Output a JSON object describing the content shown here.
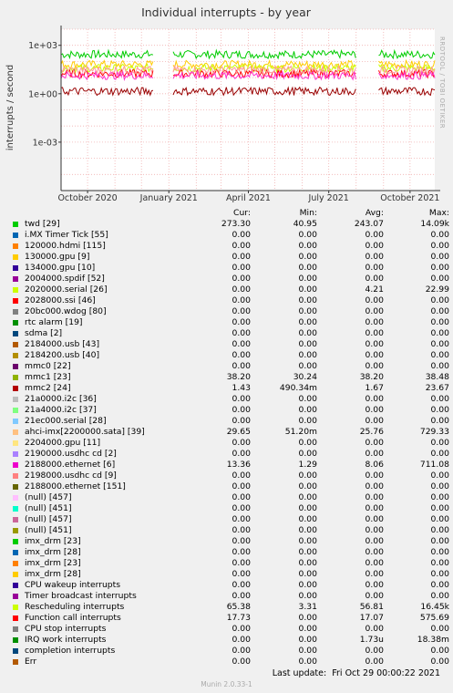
{
  "chart_data": {
    "type": "line",
    "title": "Individual interrupts - by year",
    "ylabel": "interrupts / second",
    "yscale": "log",
    "ylim": [
      1e-06,
      10000
    ],
    "y_ticks": [
      {
        "value": 1000,
        "label": "1e+03"
      },
      {
        "value": 1,
        "label": "1e+00"
      },
      {
        "value": 0.001,
        "label": "1e-03"
      }
    ],
    "xlim": [
      "2020-09-01",
      "2021-10-29"
    ],
    "x_ticks": [
      {
        "value": "2020-10-01",
        "label": "October 2020"
      },
      {
        "value": "2021-01-01",
        "label": "January 2021"
      },
      {
        "value": "2021-04-01",
        "label": "April 2021"
      },
      {
        "value": "2021-07-01",
        "label": "July 2021"
      },
      {
        "value": "2021-10-01",
        "label": "October 2021"
      }
    ],
    "grid": true,
    "gaps": [
      [
        "2020-12-15",
        "2021-01-05"
      ],
      [
        "2021-08-01",
        "2021-08-25"
      ]
    ],
    "series": [
      {
        "name": "twd [29]",
        "color": "#00cc00",
        "value": 273.3
      },
      {
        "name": "Rescheduling interrupts",
        "color": "#ffcc00",
        "value": 65.38
      },
      {
        "name": "mmc1 [23]",
        "color": "#ccff00",
        "value": 38.2
      },
      {
        "name": "Function call interrupts",
        "color": "#ff0000",
        "value": 17.73
      },
      {
        "name": "ahci-imx[2200000.sata] [39]",
        "color": "#ff9999",
        "value": 29.65
      },
      {
        "name": "2188000.ethernet [6]",
        "color": "#ff33cc",
        "value": 13.36
      },
      {
        "name": "mmc2 [24]",
        "color": "#990000",
        "value": 1.43
      }
    ]
  },
  "sidebar_text": "RRDTOOL / TOBI OETIKER",
  "legend": {
    "headers": {
      "cur": "Cur:",
      "min": "Min:",
      "avg": "Avg:",
      "max": "Max:"
    },
    "rows": [
      {
        "name": "twd [29]",
        "color": "#00cc00",
        "cur": "273.30",
        "min": "40.95",
        "avg": "243.07",
        "max": "14.09k"
      },
      {
        "name": "i.MX Timer Tick [55]",
        "color": "#0066b3",
        "cur": "0.00",
        "min": "0.00",
        "avg": "0.00",
        "max": "0.00"
      },
      {
        "name": "120000.hdmi [115]",
        "color": "#ff8000",
        "cur": "0.00",
        "min": "0.00",
        "avg": "0.00",
        "max": "0.00"
      },
      {
        "name": "130000.gpu [9]",
        "color": "#ffcc00",
        "cur": "0.00",
        "min": "0.00",
        "avg": "0.00",
        "max": "0.00"
      },
      {
        "name": "134000.gpu [10]",
        "color": "#330099",
        "cur": "0.00",
        "min": "0.00",
        "avg": "0.00",
        "max": "0.00"
      },
      {
        "name": "2004000.spdif [52]",
        "color": "#990099",
        "cur": "0.00",
        "min": "0.00",
        "avg": "0.00",
        "max": "0.00"
      },
      {
        "name": "2020000.serial [26]",
        "color": "#ccff00",
        "cur": "0.00",
        "min": "0.00",
        "avg": "4.21",
        "max": "22.99"
      },
      {
        "name": "2028000.ssi [46]",
        "color": "#ff0000",
        "cur": "0.00",
        "min": "0.00",
        "avg": "0.00",
        "max": "0.00"
      },
      {
        "name": "20bc000.wdog [80]",
        "color": "#808080",
        "cur": "0.00",
        "min": "0.00",
        "avg": "0.00",
        "max": "0.00"
      },
      {
        "name": "rtc alarm [19]",
        "color": "#008f00",
        "cur": "0.00",
        "min": "0.00",
        "avg": "0.00",
        "max": "0.00"
      },
      {
        "name": "sdma [2]",
        "color": "#00487d",
        "cur": "0.00",
        "min": "0.00",
        "avg": "0.00",
        "max": "0.00"
      },
      {
        "name": "2184000.usb [43]",
        "color": "#b35a00",
        "cur": "0.00",
        "min": "0.00",
        "avg": "0.00",
        "max": "0.00"
      },
      {
        "name": "2184200.usb [40]",
        "color": "#b38f00",
        "cur": "0.00",
        "min": "0.00",
        "avg": "0.00",
        "max": "0.00"
      },
      {
        "name": "mmc0 [22]",
        "color": "#6b006b",
        "cur": "0.00",
        "min": "0.00",
        "avg": "0.00",
        "max": "0.00"
      },
      {
        "name": "mmc1 [23]",
        "color": "#8fb300",
        "cur": "38.20",
        "min": "30.24",
        "avg": "38.20",
        "max": "38.48"
      },
      {
        "name": "mmc2 [24]",
        "color": "#b30000",
        "cur": "1.43",
        "min": "490.34m",
        "avg": "1.67",
        "max": "23.67"
      },
      {
        "name": "21a0000.i2c [36]",
        "color": "#bebebe",
        "cur": "0.00",
        "min": "0.00",
        "avg": "0.00",
        "max": "0.00"
      },
      {
        "name": "21a4000.i2c [37]",
        "color": "#80ff80",
        "cur": "0.00",
        "min": "0.00",
        "avg": "0.00",
        "max": "0.00"
      },
      {
        "name": "21ec000.serial [28]",
        "color": "#80c9ff",
        "cur": "0.00",
        "min": "0.00",
        "avg": "0.00",
        "max": "0.00"
      },
      {
        "name": "ahci-imx[2200000.sata] [39]",
        "color": "#ffc080",
        "cur": "29.65",
        "min": "51.20m",
        "avg": "25.76",
        "max": "729.33"
      },
      {
        "name": "2204000.gpu [11]",
        "color": "#ffe680",
        "cur": "0.00",
        "min": "0.00",
        "avg": "0.00",
        "max": "0.00"
      },
      {
        "name": "2190000.usdhc cd [2]",
        "color": "#aa80ff",
        "cur": "0.00",
        "min": "0.00",
        "avg": "0.00",
        "max": "0.00"
      },
      {
        "name": "2188000.ethernet [6]",
        "color": "#ee00cc",
        "cur": "13.36",
        "min": "1.29",
        "avg": "8.06",
        "max": "711.08"
      },
      {
        "name": "2198000.usdhc cd [9]",
        "color": "#ff8080",
        "cur": "0.00",
        "min": "0.00",
        "avg": "0.00",
        "max": "0.00"
      },
      {
        "name": "2188000.ethernet [151]",
        "color": "#666600",
        "cur": "0.00",
        "min": "0.00",
        "avg": "0.00",
        "max": "0.00"
      },
      {
        "name": "(null) [457]",
        "color": "#ffbfff",
        "cur": "0.00",
        "min": "0.00",
        "avg": "0.00",
        "max": "0.00"
      },
      {
        "name": "(null) [451]",
        "color": "#00ffcc",
        "cur": "0.00",
        "min": "0.00",
        "avg": "0.00",
        "max": "0.00"
      },
      {
        "name": "(null) [457]",
        "color": "#cc6699",
        "cur": "0.00",
        "min": "0.00",
        "avg": "0.00",
        "max": "0.00"
      },
      {
        "name": "(null) [451]",
        "color": "#999900",
        "cur": "0.00",
        "min": "0.00",
        "avg": "0.00",
        "max": "0.00"
      },
      {
        "name": "imx_drm [23]",
        "color": "#00cc00",
        "cur": "0.00",
        "min": "0.00",
        "avg": "0.00",
        "max": "0.00"
      },
      {
        "name": "imx_drm [28]",
        "color": "#0066b3",
        "cur": "0.00",
        "min": "0.00",
        "avg": "0.00",
        "max": "0.00"
      },
      {
        "name": "imx_drm [23]",
        "color": "#ff8000",
        "cur": "0.00",
        "min": "0.00",
        "avg": "0.00",
        "max": "0.00"
      },
      {
        "name": "imx_drm [28]",
        "color": "#ffcc00",
        "cur": "0.00",
        "min": "0.00",
        "avg": "0.00",
        "max": "0.00"
      },
      {
        "name": "CPU wakeup interrupts",
        "color": "#330099",
        "cur": "0.00",
        "min": "0.00",
        "avg": "0.00",
        "max": "0.00"
      },
      {
        "name": "Timer broadcast interrupts",
        "color": "#990099",
        "cur": "0.00",
        "min": "0.00",
        "avg": "0.00",
        "max": "0.00"
      },
      {
        "name": "Rescheduling interrupts",
        "color": "#ccff00",
        "cur": "65.38",
        "min": "3.31",
        "avg": "56.81",
        "max": "16.45k"
      },
      {
        "name": "Function call interrupts",
        "color": "#ff0000",
        "cur": "17.73",
        "min": "0.00",
        "avg": "17.07",
        "max": "575.69"
      },
      {
        "name": "CPU stop interrupts",
        "color": "#808080",
        "cur": "0.00",
        "min": "0.00",
        "avg": "0.00",
        "max": "0.00"
      },
      {
        "name": "IRQ work interrupts",
        "color": "#008f00",
        "cur": "0.00",
        "min": "0.00",
        "avg": "1.73u",
        "max": "18.38m"
      },
      {
        "name": "completion interrupts",
        "color": "#00487d",
        "cur": "0.00",
        "min": "0.00",
        "avg": "0.00",
        "max": "0.00"
      },
      {
        "name": "Err",
        "color": "#b35a00",
        "cur": "0.00",
        "min": "0.00",
        "avg": "0.00",
        "max": "0.00"
      }
    ]
  },
  "footer": {
    "last_update": "Last update:  Fri Oct 29 00:00:22 2021",
    "munin_version": "Munin 2.0.33-1"
  }
}
